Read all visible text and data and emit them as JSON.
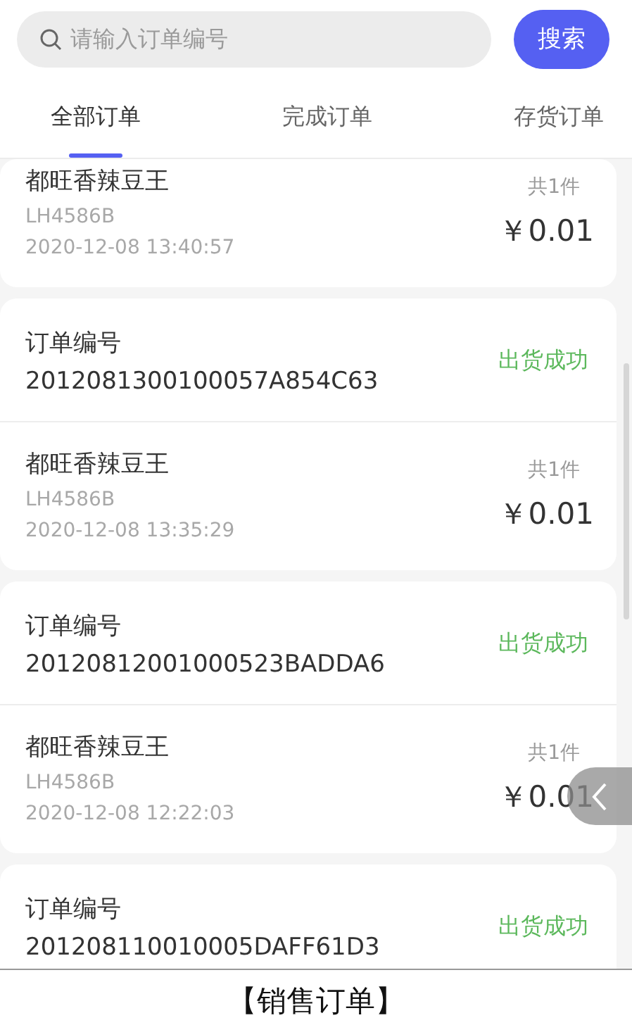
{
  "search": {
    "placeholder": "请输入订单编号",
    "button": "搜索"
  },
  "tabs": [
    {
      "label": "全部订单",
      "selected": true
    },
    {
      "label": "完成订单",
      "selected": false
    },
    {
      "label": "存货订单",
      "selected": false
    }
  ],
  "orders": [
    {
      "product": {
        "name": "都旺香辣豆王",
        "code": "LH4586B",
        "time": "2020-12-08 13:40:57",
        "count": "共1件",
        "price": "￥0.01"
      }
    },
    {
      "label": "订单编号",
      "number": "2012081300100057A854C63",
      "status": "出货成功",
      "product": {
        "name": "都旺香辣豆王",
        "code": "LH4586B",
        "time": "2020-12-08 13:35:29",
        "count": "共1件",
        "price": "￥0.01"
      }
    },
    {
      "label": "订单编号",
      "number": "20120812001000523BADDA6",
      "status": "出货成功",
      "product": {
        "name": "都旺香辣豆王",
        "code": "LH4586B",
        "time": "2020-12-08 12:22:03",
        "count": "共1件",
        "price": "￥0.01"
      }
    },
    {
      "label": "订单编号",
      "number": "201208110010005DAFF61D3",
      "status": "出货成功"
    }
  ],
  "caption": "【销售订单】"
}
